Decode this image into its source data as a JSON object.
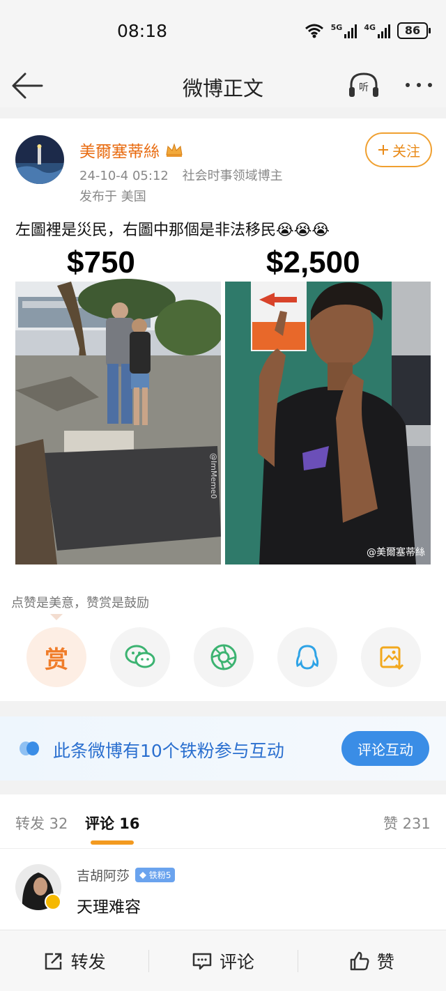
{
  "status": {
    "time": "08:18",
    "signal1": "5G",
    "signal2": "4G",
    "battery": "86"
  },
  "nav": {
    "title": "微博正文",
    "listen_icon_text": "听"
  },
  "post": {
    "author": "美爾塞蒂絲",
    "date": "24-10-4 05:12",
    "tag": "社会时事领域博主",
    "location": "发布于 美国",
    "follow_label": "关注",
    "text": "左圖裡是災民，右圖中那個是非法移民😭😭😭",
    "image": {
      "left_price": "$750",
      "right_price": "$2,500",
      "watermark": "@美爾塞蒂絲",
      "side_mark": "@ImMeme0"
    }
  },
  "reward": {
    "hint": "点赞是美意，赞赏是鼓励",
    "reward_label": "赏"
  },
  "fans": {
    "text": "此条微博有10个铁粉参与互动",
    "button": "评论互动"
  },
  "tabs": {
    "repost": "转发 32",
    "comments": "评论 16",
    "likes": "赞 231"
  },
  "comment": {
    "name": "吉胡阿莎",
    "badge": "铁粉5",
    "text": "天理难容"
  },
  "bottom": {
    "repost": "转发",
    "comment": "评论",
    "like": "赞"
  }
}
